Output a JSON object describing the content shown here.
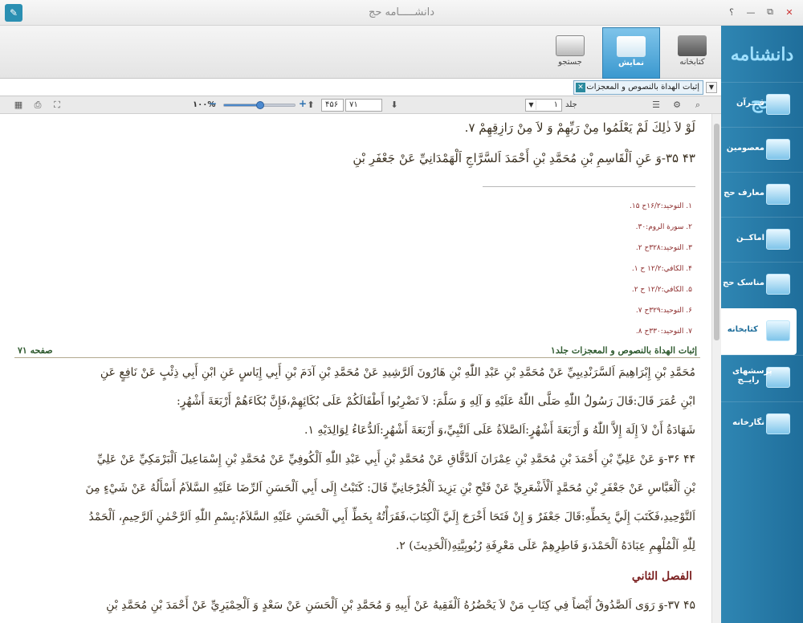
{
  "window": {
    "title": "دانشـــــامه حج",
    "buttons": [
      "؟",
      "—",
      "⧉",
      "✕"
    ]
  },
  "ribbon": {
    "tabs": [
      {
        "label": "کتابخانه",
        "icon": "books-icon"
      },
      {
        "label": "نمایش",
        "icon": "document-view-icon"
      },
      {
        "label": "جستجو",
        "icon": "magnifier-icon"
      }
    ]
  },
  "address": {
    "document_tab": "إثبات الهداة بالنصوص و المعجزات"
  },
  "toolrow": {
    "zoom": "١٠٠%",
    "zoom_level_percent": 50,
    "page_current": "٧١",
    "page_total": "۴۵۶",
    "volume_value": "١",
    "volume_label": "جلد"
  },
  "content": {
    "lines_top": [
      "لَوْ لاَ ذٰلِكَ لَمْ يَعْلَمُوا مِنْ رَبِّهِمْ وَ لاَ مِنْ رَازِقِهِمْ ٧.",
      "۴٣ ٣۵-وَ عَنِ اَلْقَاسِمِ بْنِ مُحَمَّدِ بْنِ أَحْمَدَ اَلسَّرَّاجِ اَلْهَمْدَانِيِّ عَنْ جَعْفَرِ بْنِ"
    ],
    "footnotes": [
      "١. التوحيد:١۶/٢ح ١۵.",
      "٢. سورة الروم:٣٠.",
      "٣. التوحيد:٣٢٨ح ٢.",
      "۴. الكافي:١٢/٢ ح ١.",
      "۵. الكافي:١٢/٢ ح ٢.",
      "۶. التوحيد:٣٢٩ح ٧.",
      "٧. التوحيد:٣٣٠ح ٨."
    ],
    "page_header_title": "إثبات الهداة بالنصوص و المعجزات جلد١",
    "page_header_page": "صفحه ٧١",
    "body_lines": [
      "مُحَمَّدِ بْنِ إِبْرَاهِيمَ اَلسَّرَنْدِيبِيِّ عَنْ مُحَمَّدِ بْنِ عَبْدِ اللّٰهِ بْنِ هَارُونَ اَلرَّشِيدِ عَنْ مُحَمَّدِ بْنِ آدَمَ بْنِ أَبِي إِيَاسٍ عَنِ ابْنِ أَبِي ذِئْبٍ عَنْ نَافِعٍ عَنِ",
      "ابْنِ عُمَرَ قَالَ:قَالَ رَسُولُ اللّٰهِ صَلَّى اللّٰهُ عَلَيْهِ وَ آلِهِ وَ سَلَّمَ: لاَ تَضْرِبُوا أَطْفَالَكُمْ عَلَى بُكَائِهِمْ،فَإِنَّ بُكَاءَهُمْ أَرْبَعَةَ أَشْهُرٍ:",
      "شَهَادَةُ أَنْ لاَ إِلَهَ إِلاَّ اللّٰهُ وَ أَرْبَعَةَ أَشْهُرٍ:اَلصَّلاَةُ عَلَى اَلنَّبِيِّ،وَ أَرْبَعَةَ أَشْهُرٍ:اَلدُّعَاءُ لِوَالِدَيْهِ ١.",
      "۴۴ ٣۶-وَ عَنْ عَلِيِّ بْنِ أَحْمَدَ بْنِ مُحَمَّدِ بْنِ عِمْرَانَ اَلدَّقَّاقِ عَنْ مُحَمَّدِ بْنِ أَبِي عَبْدِ اللّٰهِ اَلْكُوفِيِّ عَنْ مُحَمَّدِ بْنِ إِسْمَاعِيلَ اَلْبَرْمَكِيِّ عَنْ عَلِيِّ",
      "بْنِ اَلْعَبَّاسِ عَنْ جَعْفَرِ بْنِ مُحَمَّدٍ اَلْأَشْعَرِيِّ عَنْ فَتْحِ بْنِ يَزِيدَ اَلْجُرْجَانِيِّ قَالَ: كَتَبْتُ إِلَى أَبِي اَلْحَسَنِ اَلرِّضَا عَلَيْهِ السَّلاَمُ أَسْأَلُهُ عَنْ شَيْءٍ مِنَ",
      "اَلتَّوْحِيدِ،فَكَتَبَ إِلَيَّ بِخَطِّهِ:قَالَ جَعْفَرٌ وَ إِنْ فَتَحَا أَخْرَجَ إِلَيَّ اَلْكِتَابَ،فَقَرَأْتُهُ بِخَطِّ أَبِي اَلْحَسَنِ عَلَيْهِ السَّلاَمُ:بِسْمِ اللّٰهِ اَلرَّحْمٰنِ اَلرَّحِيمِ، اَلْحَمْدُ",
      "لِلّٰهِ اَلْمُلْهِمِ عِبَادَهُ اَلْحَمْدَ،وَ فَاطِرِهِمْ عَلَى مَعْرِفَةِ رُبُوبِيَّتِهِ(اَلْحَدِيثَ) ٢."
    ],
    "section_heading": "الفصل الثاني",
    "last_line": "۴۵ ٣٧-وَ رَوَى اَلصَّدُوقُ أَيْضاً فِي كِتَابِ مَنْ لاَ يَحْضُرُهُ اَلْفَقِيهُ عَنْ أَبِيهِ وَ مُحَمَّدِ بْنِ اَلْحَسَنِ عَنْ سَعْدٍ وَ اَلْحِمْيَرِيِّ عَنْ أَحْمَدَ بْنِ مُحَمَّدِ بْنِ"
  },
  "sidebar": {
    "logo": "دانشنامه حج",
    "items": [
      {
        "label": "قـــرآن",
        "icon": "quran-icon"
      },
      {
        "label": "معصومین",
        "icon": "shrine-icon"
      },
      {
        "label": "معارف حج",
        "icon": "book-open-icon"
      },
      {
        "label": "اماکــن",
        "icon": "mosque-icon"
      },
      {
        "label": "مناسک حج",
        "icon": "pilgrim-icon"
      },
      {
        "label": "کتابخانه",
        "icon": "library-books-icon"
      },
      {
        "label": "پرسشهای رایــج",
        "icon": "faq-icon"
      },
      {
        "label": "نگارخانه",
        "icon": "gallery-icon"
      }
    ],
    "active_index": 5
  }
}
